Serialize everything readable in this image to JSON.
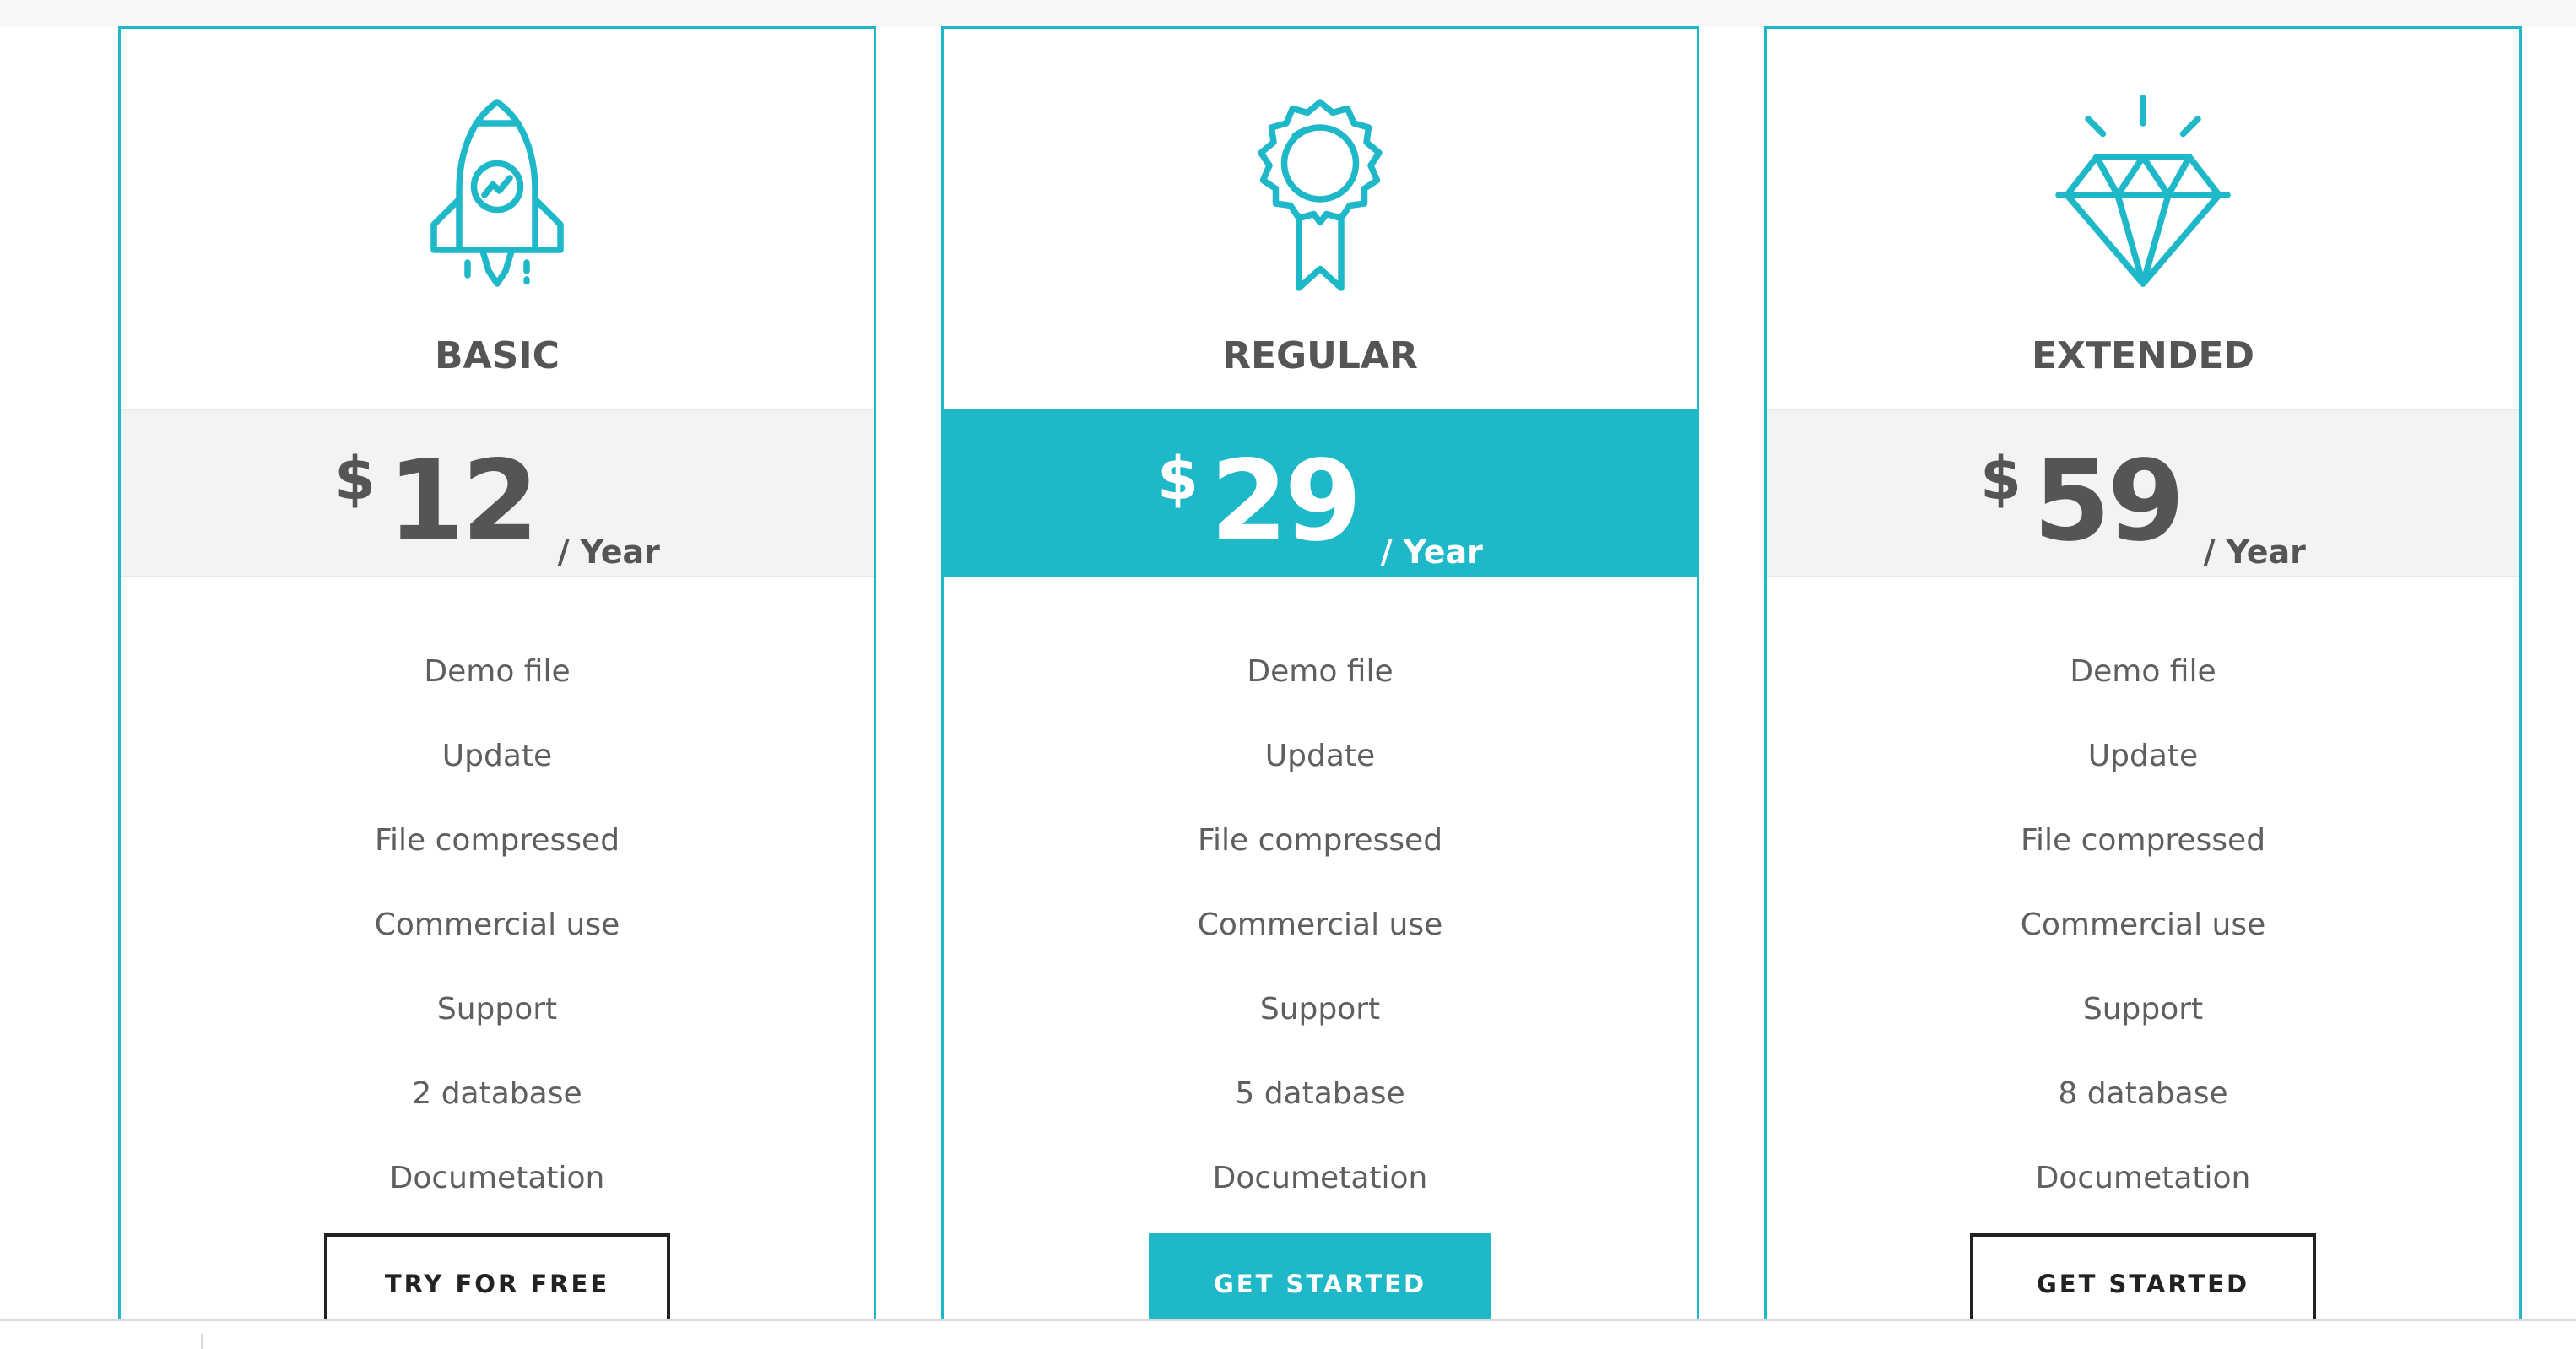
{
  "colors": {
    "accent": "#1eb8c8",
    "text": "#555555",
    "band": "#f3f3f3"
  },
  "plans": [
    {
      "icon": "rocket-icon",
      "name": "BASIC",
      "currency": "$",
      "price": "12",
      "period": "/ Year",
      "featured": false,
      "features": [
        "Demo file",
        "Update",
        "File compressed",
        "Commercial use",
        "Support",
        "2 database",
        "Documetation"
      ],
      "cta": "TRY FOR FREE"
    },
    {
      "icon": "award-ribbon-icon",
      "name": "REGULAR",
      "currency": "$",
      "price": "29",
      "period": "/ Year",
      "featured": true,
      "features": [
        "Demo file",
        "Update",
        "File compressed",
        "Commercial use",
        "Support",
        "5 database",
        "Documetation"
      ],
      "cta": "GET STARTED"
    },
    {
      "icon": "diamond-icon",
      "name": "EXTENDED",
      "currency": "$",
      "price": "59",
      "period": "/ Year",
      "featured": false,
      "features": [
        "Demo file",
        "Update",
        "File compressed",
        "Commercial use",
        "Support",
        "8 database",
        "Documetation"
      ],
      "cta": "GET STARTED"
    }
  ]
}
